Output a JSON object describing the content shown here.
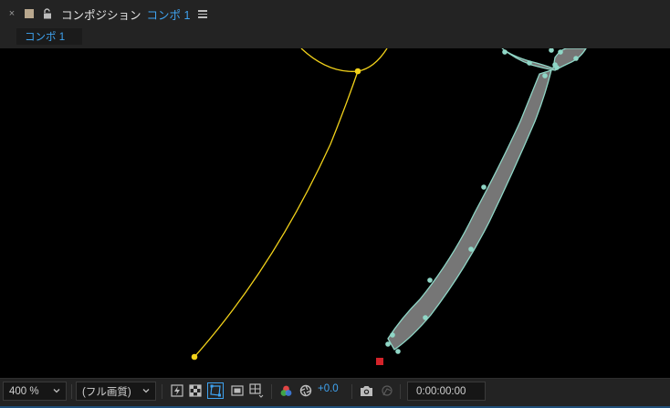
{
  "header": {
    "close_glyph": "×",
    "title": "コンポジション",
    "comp_name": "コンポ 1"
  },
  "tabs": [
    {
      "label": "コンポ 1",
      "active": true
    }
  ],
  "viewer": {
    "shape_fill_color": "#767676",
    "shape_stroke_color": "#8fd6c6",
    "path_color": "#f2d21a",
    "anchor_color": "#d4232a"
  },
  "toolbar": {
    "magnification": "400 %",
    "resolution": "(フル画質)",
    "exposure": "+0.0",
    "timecode": "0:00:00:00"
  },
  "colors": {
    "accent": "#3fa3f0",
    "panel": "#232323",
    "viewer_bg": "#000000"
  }
}
